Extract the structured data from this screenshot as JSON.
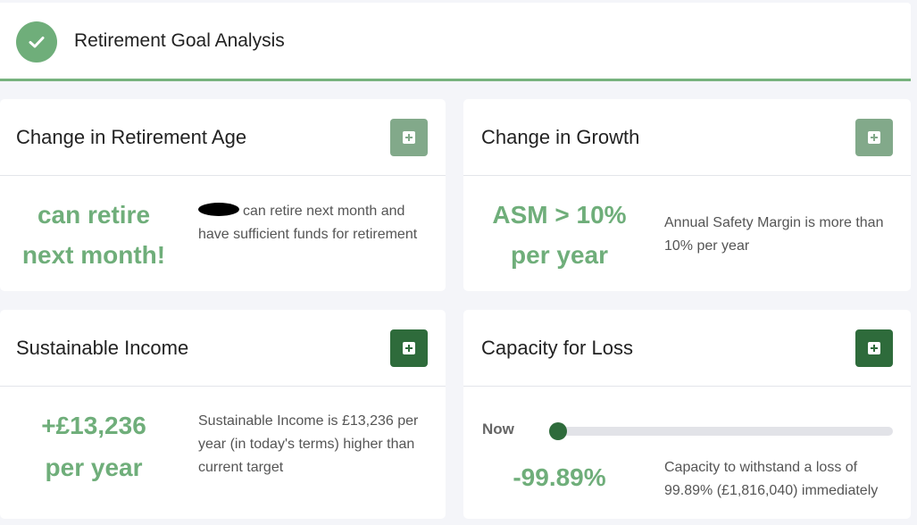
{
  "header": {
    "title": "Retirement Goal Analysis",
    "status_icon": "check-circle-icon",
    "accent_color": "#77b27e"
  },
  "cards": {
    "retirement_age": {
      "title": "Change in Retirement Age",
      "headline_line1": "can retire",
      "headline_line2": "next month!",
      "description": "can retire next month and have sufficient funds for retirement",
      "expand_icon": "plus-square-icon"
    },
    "growth": {
      "title": "Change in Growth",
      "headline_line1": "ASM > 10%",
      "headline_line2": "per year",
      "description": "Annual Safety Margin is more than 10% per year",
      "expand_icon": "plus-square-icon"
    },
    "income": {
      "title": "Sustainable Income",
      "headline_line1": "+£13,236",
      "headline_line2": "per year",
      "description": "Sustainable Income is £13,236 per year (in today's terms) higher than current target",
      "expand_icon": "plus-square-icon"
    },
    "loss": {
      "title": "Capacity for Loss",
      "slider_label": "Now",
      "slider_position": 0,
      "headline": "-99.89%",
      "description": "Capacity to withstand a loss of 99.89% (£1,816,040) immediately",
      "expand_icon": "plus-square-icon"
    }
  },
  "colors": {
    "headline_green": "#6fae7a",
    "button_light": "#82a98a",
    "button_dark": "#2e6b3b"
  }
}
